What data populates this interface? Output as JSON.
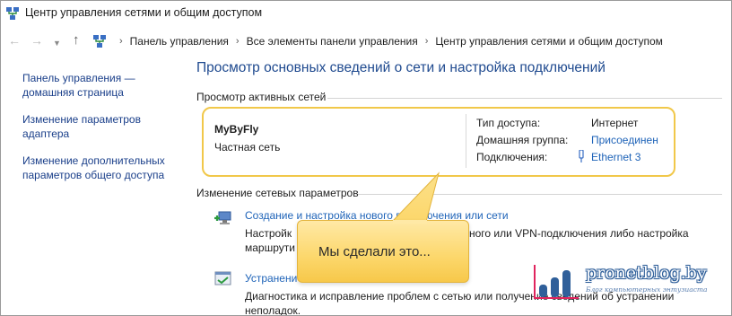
{
  "window": {
    "title": "Центр управления сетями и общим доступом"
  },
  "address_bar": {
    "breadcrumbs": [
      "Панель управления",
      "Все элементы панели управления",
      "Центр управления сетями и общим доступом"
    ],
    "separator": "›"
  },
  "sidebar": {
    "items": [
      "Панель управления — домашняя страница",
      "Изменение параметров адаптера",
      "Изменение дополнительных параметров общего доступа"
    ]
  },
  "main": {
    "title": "Просмотр основных сведений о сети и настройка подключений",
    "active_networks_heading": "Просмотр активных сетей",
    "network": {
      "name": "MyByFly",
      "type": "Частная сеть",
      "access_type_label": "Тип доступа:",
      "access_type_value": "Интернет",
      "homegroup_label": "Домашняя группа:",
      "homegroup_value": "Присоединен",
      "connections_label": "Подключения:",
      "connections_value": "Ethernet 3"
    },
    "change_settings_heading": "Изменение сетевых параметров",
    "tasks": [
      {
        "link": "Создание и настройка нового подключения или сети",
        "desc_line1": "Настройк",
        "desc_line1_end": "ного или VPN-подключения либо настройка",
        "desc_line2": "маршрути",
        "icon": "network-wizard-icon"
      },
      {
        "link": "Устранени",
        "desc_line1": "Диагностика и исправление проблем с сетью или получение сведений об устранении",
        "desc_line2": "неполадок.",
        "icon": "troubleshoot-icon"
      }
    ]
  },
  "callout": {
    "text": "Мы сделали это..."
  },
  "watermark": {
    "site": "pronetblog.by",
    "slogan": "Блог компьютерных энтузиаста"
  },
  "colors": {
    "link": "#1e63b8",
    "title": "#1f4a8f",
    "highlight_border": "#f1c84a",
    "callout_fill": "#fcd76b"
  }
}
